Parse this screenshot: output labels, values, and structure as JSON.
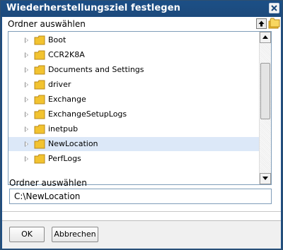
{
  "dialog": {
    "title": "Wiederherstellungsziel festlegen"
  },
  "tree": {
    "header_label": "Ordner auswählen",
    "items": [
      {
        "label": "Boot"
      },
      {
        "label": "CCR2K8A"
      },
      {
        "label": "Documents and Settings"
      },
      {
        "label": "driver"
      },
      {
        "label": "Exchange"
      },
      {
        "label": "ExchangeSetupLogs"
      },
      {
        "label": "inetpub"
      },
      {
        "label": "NewLocation",
        "selected": true
      },
      {
        "label": "PerfLogs"
      }
    ]
  },
  "path": {
    "label": "Ordner auswählen",
    "value": "C:\\NewLocation"
  },
  "buttons": {
    "ok": "OK",
    "cancel": "Abbrechen"
  },
  "icons": {
    "close": "close-icon",
    "up": "arrow-up-icon",
    "new_folder": "new-folder-icon",
    "folder": "folder-icon",
    "expander": "expand-triangle-icon"
  },
  "colors": {
    "titlebar": "#1d4a7c",
    "selection": "#dce8f8",
    "folder": "#f2c330"
  }
}
